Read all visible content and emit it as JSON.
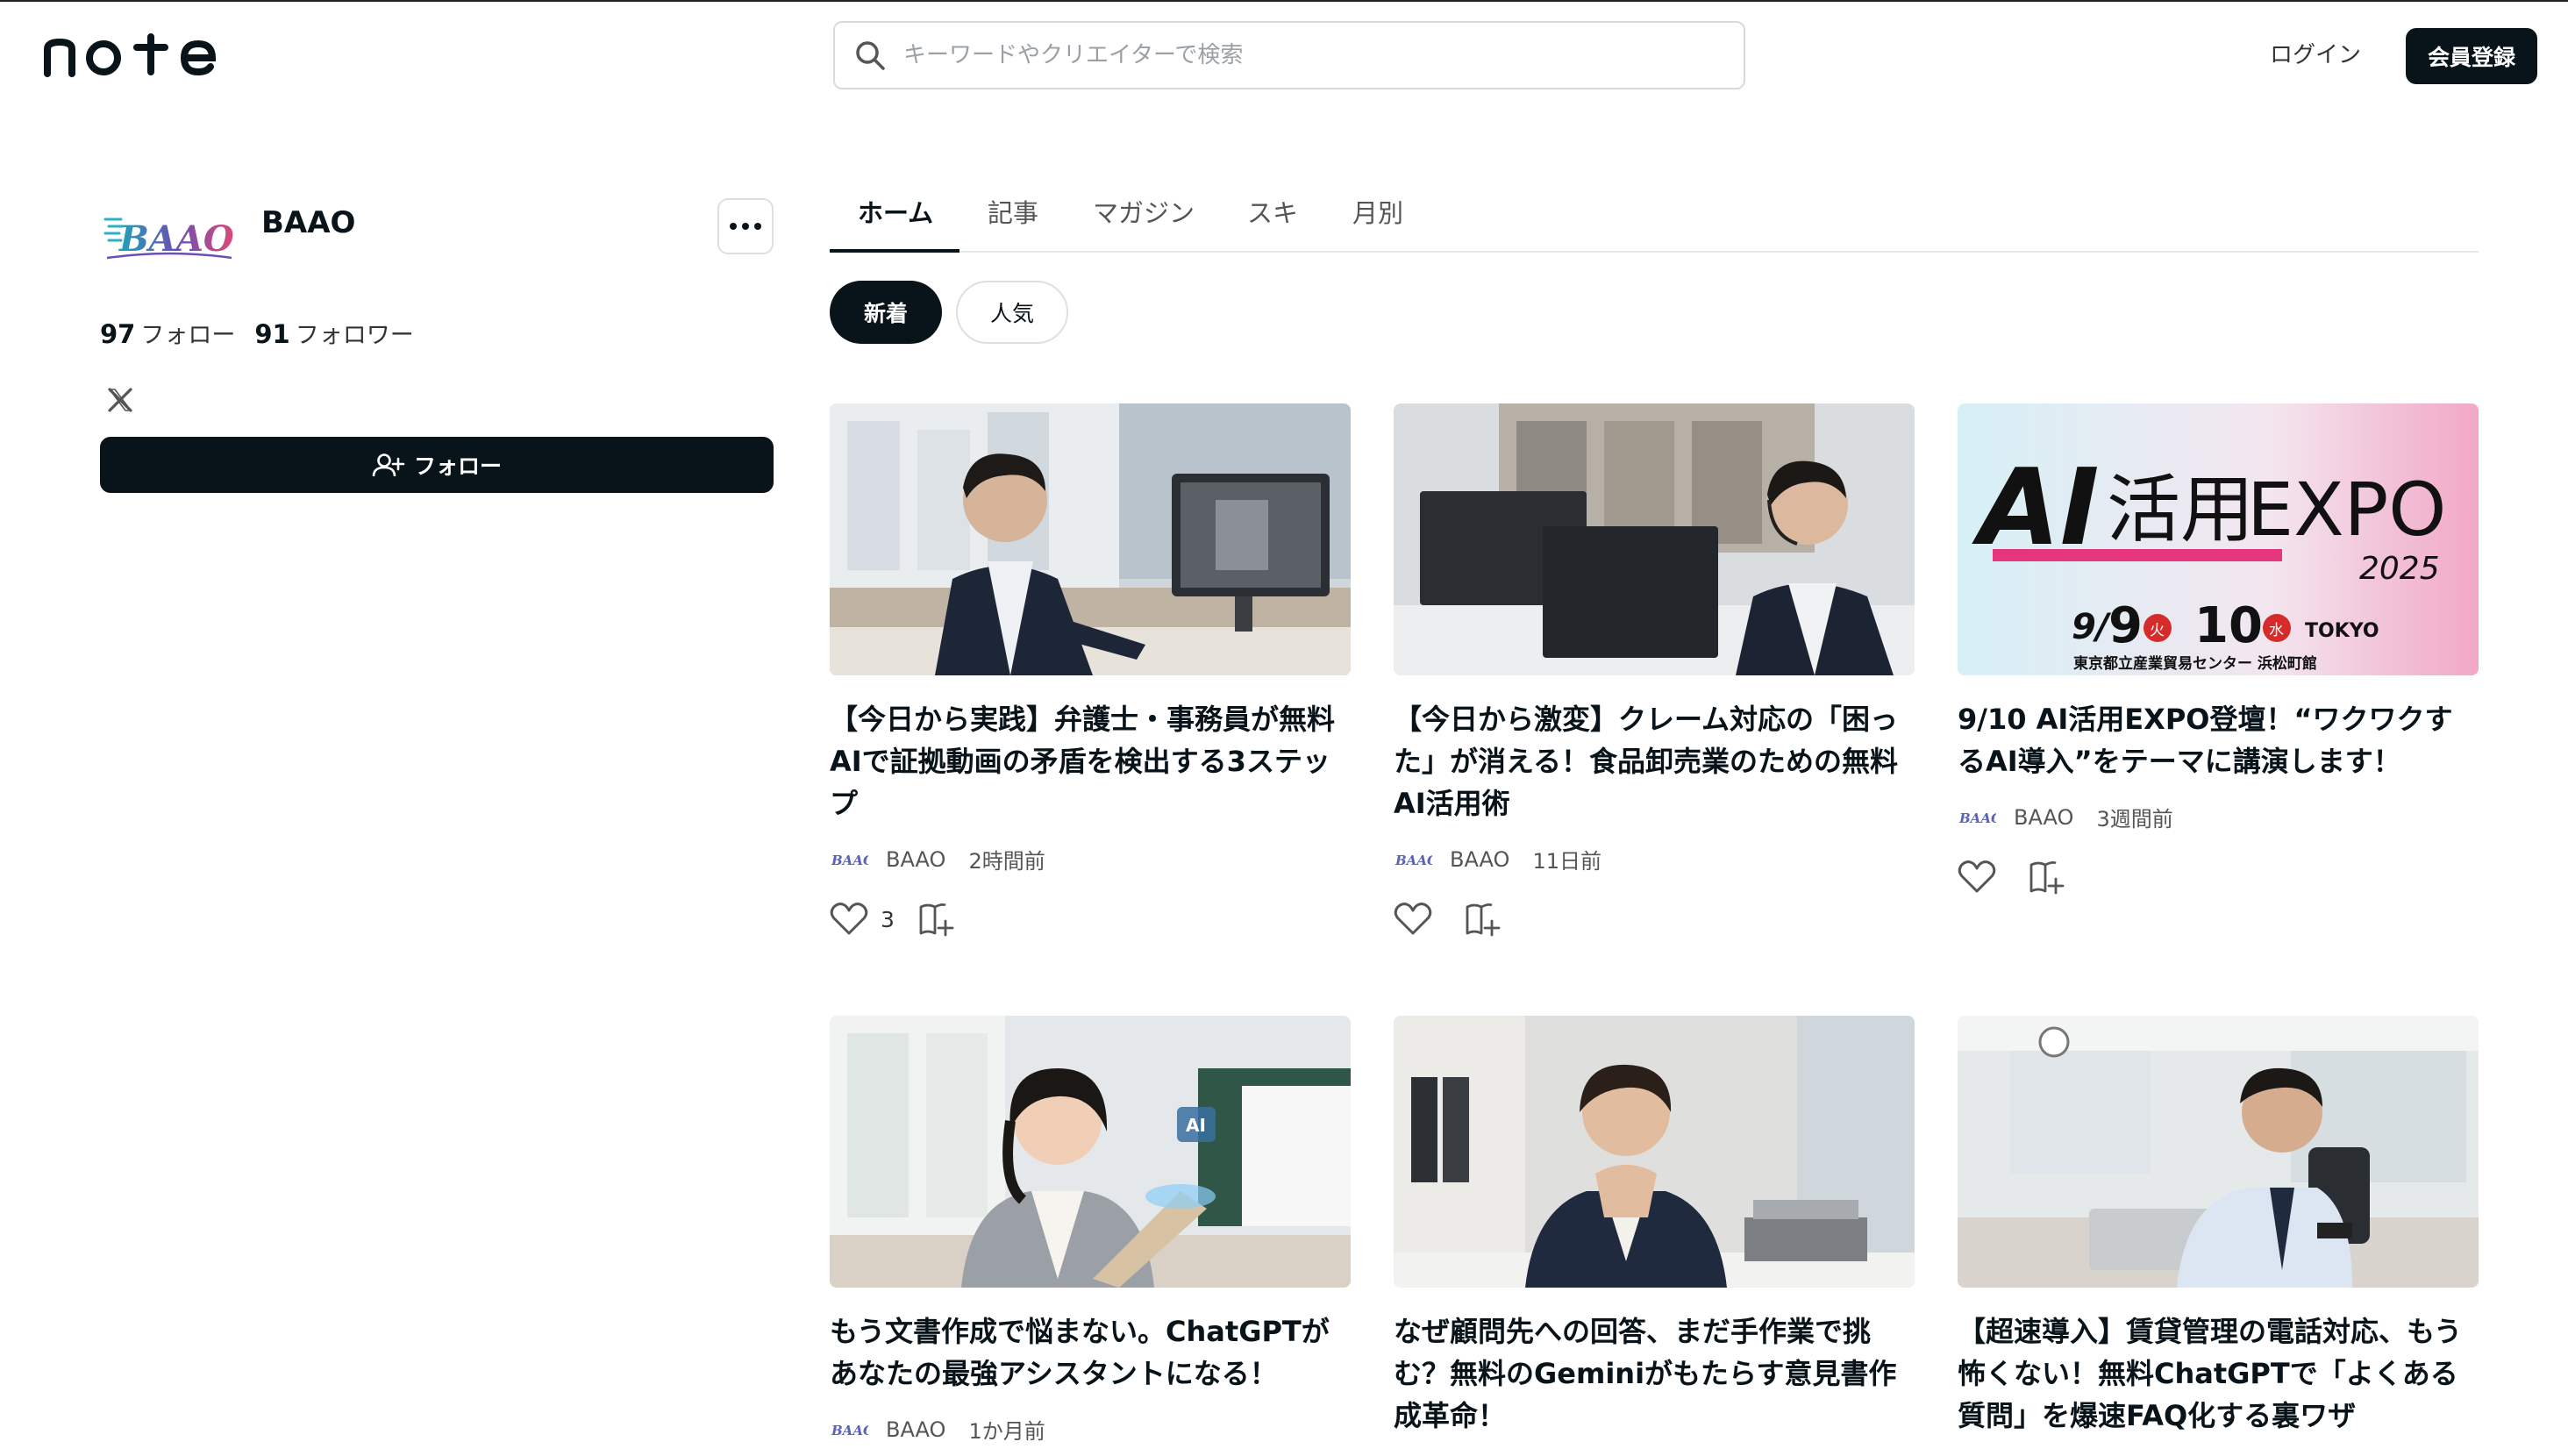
{
  "header": {
    "logo_text": "note",
    "search_placeholder": "キーワードやクリエイターで検索",
    "login_label": "ログイン",
    "signup_label": "会員登録"
  },
  "profile": {
    "name": "BAAO",
    "avatar_text": "BAAO",
    "following_count": "97",
    "following_label": "フォロー",
    "followers_count": "91",
    "followers_label": "フォロワー",
    "follow_button_label": "フォロー"
  },
  "tabs": [
    {
      "label": "ホーム"
    },
    {
      "label": "記事"
    },
    {
      "label": "マガジン"
    },
    {
      "label": "スキ"
    },
    {
      "label": "月別"
    }
  ],
  "filters": [
    {
      "label": "新着"
    },
    {
      "label": "人気"
    }
  ],
  "articles": [
    {
      "title": "【今日から実践】弁護士・事務員が無料AIで証拠動画の矛盾を検出する3ステップ",
      "author": "BAAO",
      "time": "2時間前",
      "likes": "3"
    },
    {
      "title": "【今日から激変】クレーム対応の「困った」が消える！食品卸売業のための無料AI活用術",
      "author": "BAAO",
      "time": "11日前",
      "likes": ""
    },
    {
      "title": "9/10 AI活用EXPO登壇！“ワクワクするAI導入”をテーマに講演します！",
      "author": "BAAO",
      "time": "3週間前",
      "likes": ""
    },
    {
      "title": "もう文書作成で悩まない。ChatGPTがあなたの最強アシスタントになる！",
      "author": "BAAO",
      "time": "1か月前",
      "likes": ""
    },
    {
      "title": "なぜ顧問先への回答、まだ手作業で挑む？無料のGeminiがもたらす意見書作成革命！",
      "author": "",
      "time": "",
      "likes": ""
    },
    {
      "title": "【超速導入】賃貸管理の電話対応、もう怖くない！無料ChatGPTで「よくある質問」を爆速FAQ化する裏ワザ",
      "author": "",
      "time": "",
      "likes": ""
    }
  ],
  "expo_banner": {
    "headline_ai": "AI",
    "headline_jp": "活用",
    "headline_expo": "EXPO",
    "year": "2025",
    "date_month": "9/",
    "date_day1": "9",
    "weekday1": "火",
    "date_day2": "10",
    "weekday2": "水",
    "city": "TOKYO",
    "venue": "東京都立産業貿易センター 浜松町館"
  },
  "thumb_badge": "AI",
  "colors": {
    "accent": "#08131a",
    "border": "#dde0e3",
    "muted": "#555555"
  },
  "icons": [
    "search-icon",
    "more-icon",
    "x-logo-icon",
    "add-user-icon",
    "heart-icon",
    "magazine-add-icon"
  ]
}
